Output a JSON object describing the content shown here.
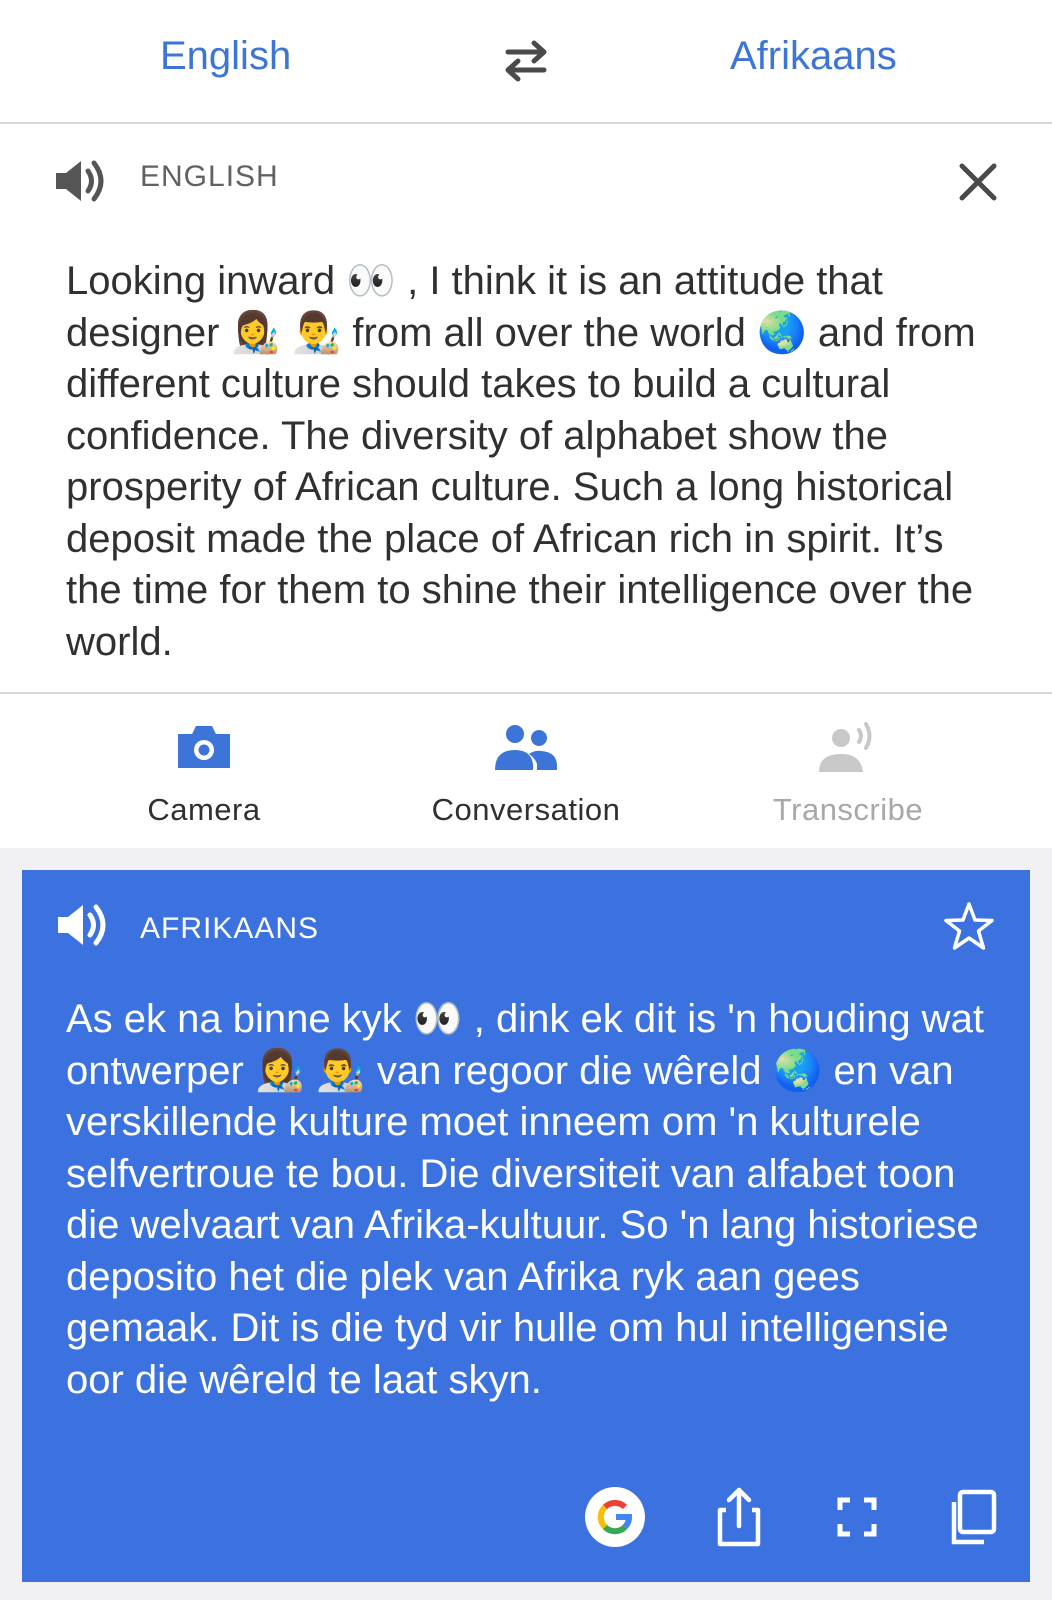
{
  "header": {
    "source_lang": "English",
    "target_lang": "Afrikaans"
  },
  "source": {
    "label": "ENGLISH",
    "text": "Looking inward 👀 , I think it is an attitude  that designer 👩‍🎨  👨‍🎨  from all over the world 🌏 and from different culture should takes to build a cultural confidence. The diversity of alphabet show the prosperity of African culture. Such a long historical deposit made the place of African rich in spirit. It’s the time for them to shine their intelligence over the world."
  },
  "tools": [
    {
      "label": "Camera",
      "icon": "camera-icon",
      "enabled": true
    },
    {
      "label": "Conversation",
      "icon": "people-icon",
      "enabled": true
    },
    {
      "label": "Transcribe",
      "icon": "transcribe-icon",
      "enabled": false
    }
  ],
  "result": {
    "label": "AFRIKAANS",
    "text": "As ek na binne kyk 👀 , dink ek dit is 'n houding wat ontwerper 👩‍🎨  👨‍🎨  van regoor die wêreld 🌏 en van verskillende kulture moet inneem om 'n kulturele selfvertroue te bou.  Die diversiteit van alfabet toon die welvaart van Afrika-kultuur.  So 'n lang historiese deposito het die plek van Afrika ryk aan gees gemaak.  Dit is die tyd vir hulle om hul intelligensie oor die wêreld te laat skyn."
  },
  "colors": {
    "accent": "#3d74d8",
    "card": "#3b72e0",
    "text": "#303030",
    "muted": "#a8a8a8"
  }
}
